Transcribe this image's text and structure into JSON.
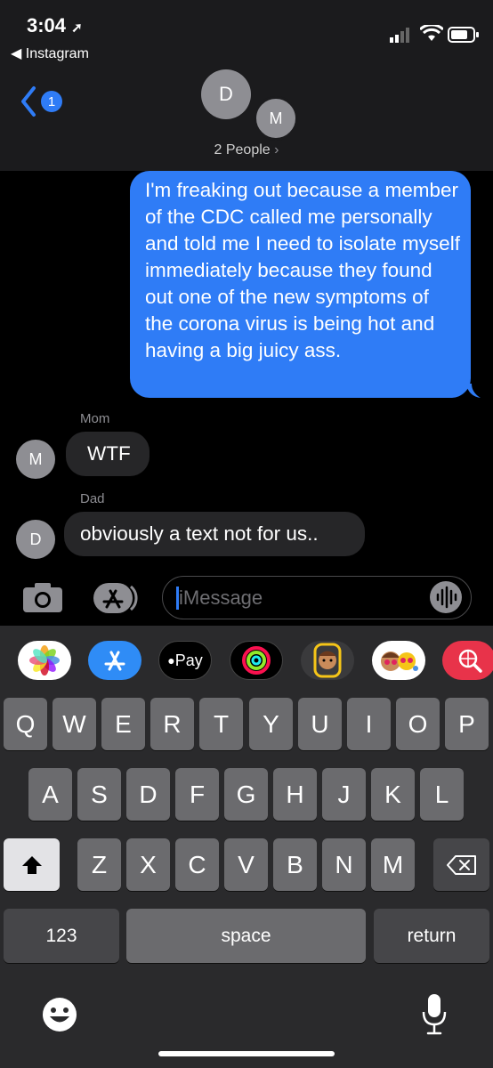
{
  "status": {
    "time": "3:04",
    "back_app": "◀ Instagram"
  },
  "header": {
    "back_badge": "1",
    "avatar1": "D",
    "avatar2": "M",
    "people_label": "2 People"
  },
  "messages": {
    "sent": "I'm freaking out because a member of the CDC called me personally and told me I need to isolate myself immediately because they found out one of the new symptoms of the corona virus is being hot and having a big juicy ass.",
    "mom_name": "Mom",
    "mom_avatar": "M",
    "mom_text": "WTF",
    "dad_name": "Dad",
    "dad_avatar": "D",
    "dad_text": "obviously a text not for us.."
  },
  "input": {
    "placeholder": "iMessage"
  },
  "apps": {
    "applepay": "Pay"
  },
  "keyboard": {
    "row1": [
      "Q",
      "W",
      "E",
      "R",
      "T",
      "Y",
      "U",
      "I",
      "O",
      "P"
    ],
    "row2": [
      "A",
      "S",
      "D",
      "F",
      "G",
      "H",
      "J",
      "K",
      "L"
    ],
    "row3": [
      "Z",
      "X",
      "C",
      "V",
      "B",
      "N",
      "M"
    ],
    "numbers": "123",
    "space": "space",
    "return": "return"
  },
  "colors": {
    "sent_bubble": "#2f7cf6",
    "received_bubble": "#262628",
    "accent": "#2f7cf6"
  }
}
